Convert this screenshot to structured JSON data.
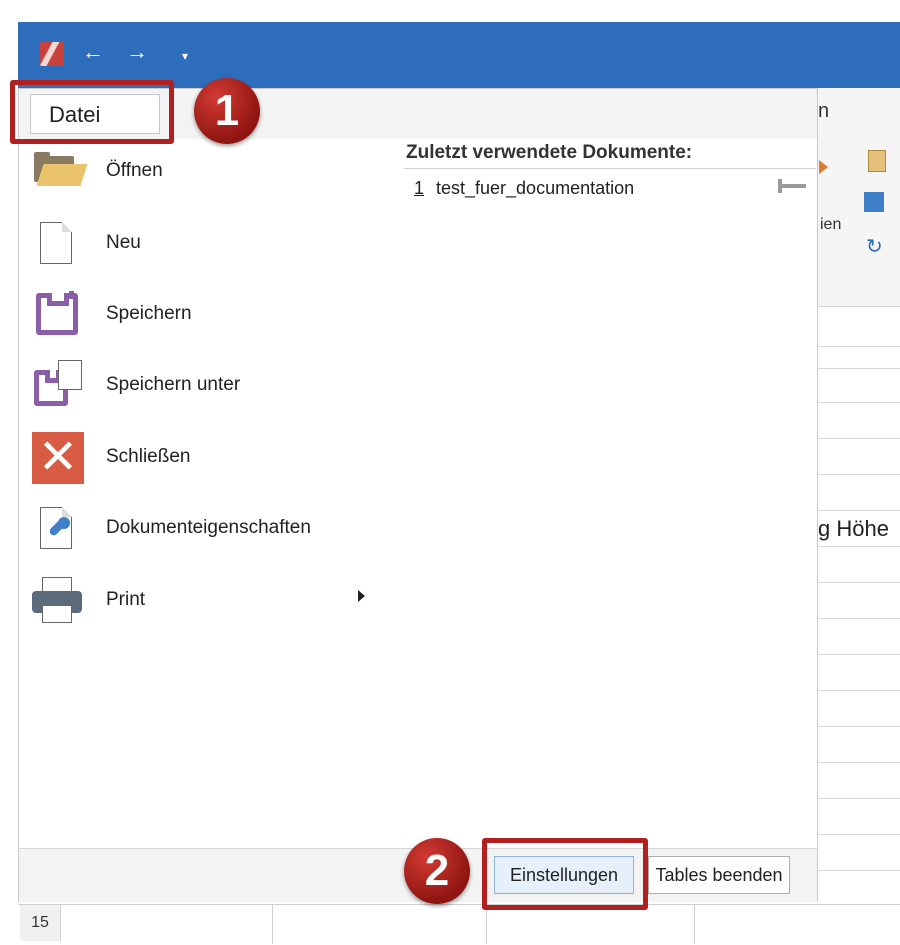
{
  "quick_access": {
    "undo_icon": "undo-arrow-icon",
    "redo_icon": "redo-arrow-icon",
    "dropdown_icon": "chevron-down-icon"
  },
  "menu": {
    "tab_label": "Datei",
    "items": [
      {
        "label": "Öffnen",
        "icon": "folder-open-icon"
      },
      {
        "label": "Neu",
        "icon": "new-document-icon"
      },
      {
        "label": "Speichern",
        "icon": "save-icon"
      },
      {
        "label": "Speichern unter",
        "icon": "save-as-icon"
      },
      {
        "label": "Schließen",
        "icon": "close-icon"
      },
      {
        "label": "Dokumenteigenschaften",
        "icon": "document-properties-icon"
      },
      {
        "label": "Print",
        "icon": "printer-icon"
      }
    ]
  },
  "recent": {
    "title": "Zuletzt verwendete Dokumente:",
    "items": [
      {
        "number": "1",
        "name": "test_fuer_documentation"
      }
    ]
  },
  "footer": {
    "settings_label": "Einstellungen",
    "exit_label": "Tables beenden"
  },
  "background": {
    "ribbon_tab_partial": "n",
    "ribbon_text_partial": "ien",
    "column_header_partial": "g Höhe",
    "row_number": "15"
  },
  "annotations": {
    "badge_1": "1",
    "badge_2": "2"
  },
  "colors": {
    "title_bar": "#2e6dbb",
    "highlight": "#b0201e",
    "save_purple": "#8b5fa8",
    "close_red": "#d85c43"
  }
}
